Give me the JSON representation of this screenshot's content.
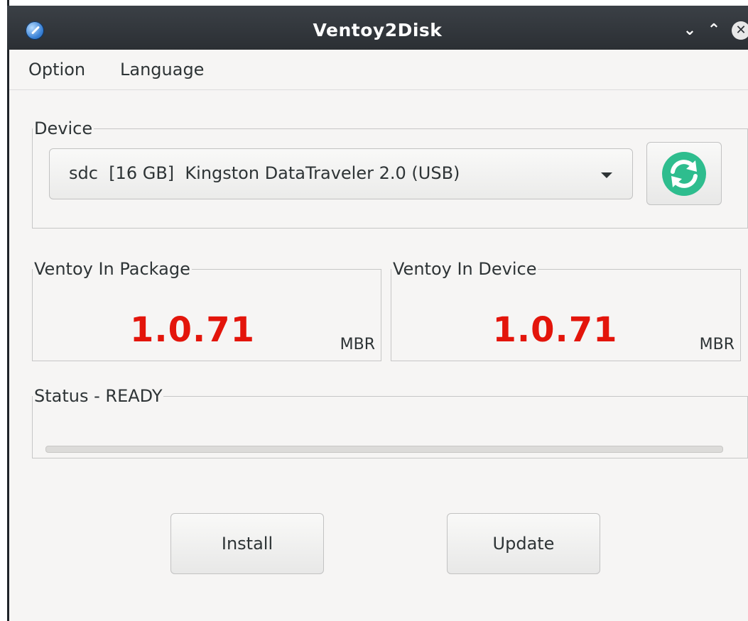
{
  "window": {
    "title": "Ventoy2Disk",
    "controls": {
      "minimize": "⌄",
      "maximize": "⌃",
      "close": "✕"
    },
    "icon": "ventoy-app-icon"
  },
  "menu": {
    "items": [
      {
        "label": "Option"
      },
      {
        "label": "Language"
      }
    ]
  },
  "device": {
    "group_label": "Device",
    "selected": "sdc  [16 GB]  Kingston DataTraveler 2.0 (USB)",
    "refresh_icon": "refresh-icon",
    "refresh_color": "#2ebd8e"
  },
  "package": {
    "group_label": "Ventoy In Package",
    "version": "1.0.71",
    "partition_style": "MBR"
  },
  "installed": {
    "group_label": "Ventoy In Device",
    "version": "1.0.71",
    "partition_style": "MBR"
  },
  "status": {
    "group_label": "Status - READY",
    "progress": 0
  },
  "actions": {
    "install_label": "Install",
    "update_label": "Update"
  },
  "colors": {
    "version": "#e3150b",
    "titlebar": "#2b2f34"
  }
}
